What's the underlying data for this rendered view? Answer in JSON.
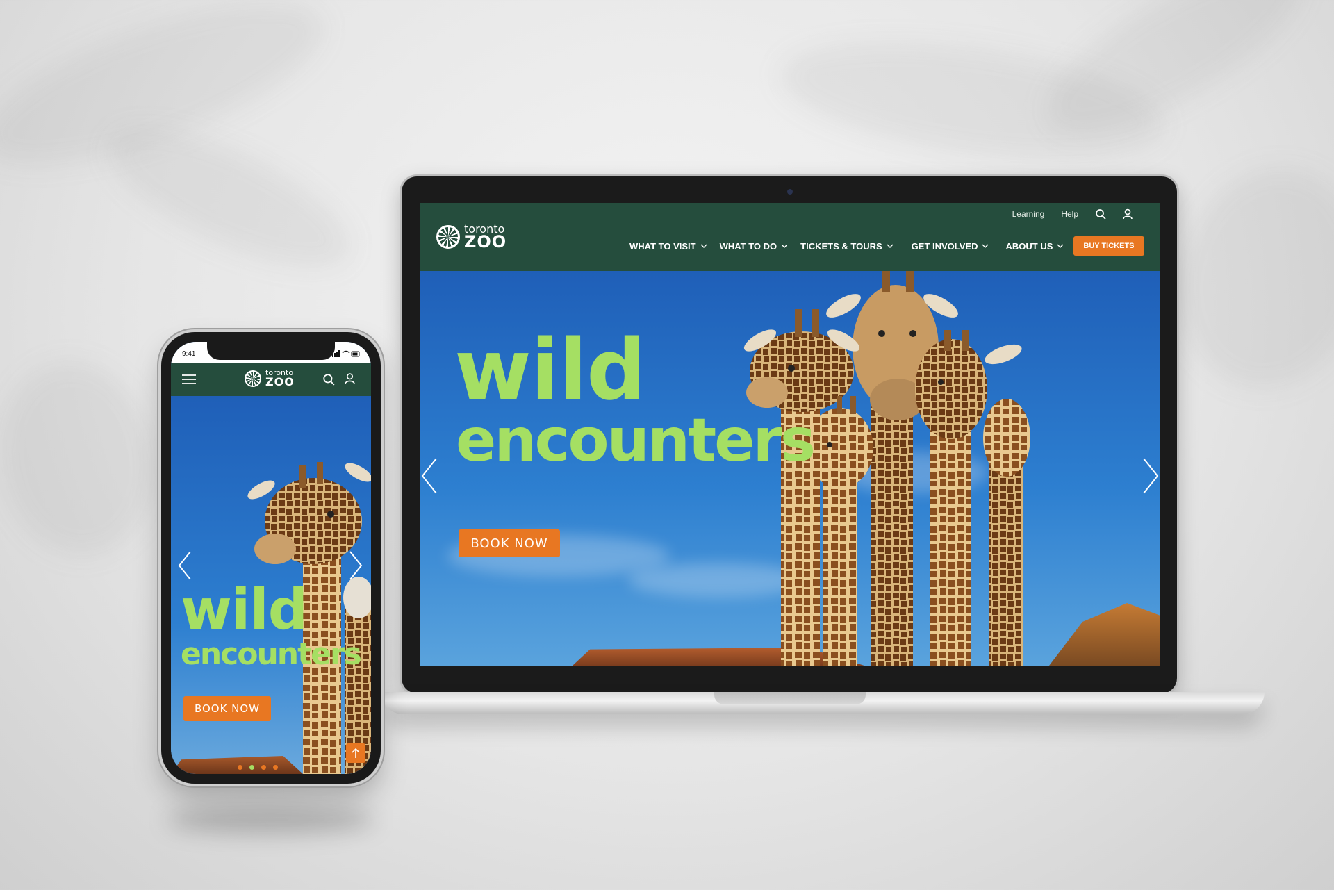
{
  "brand": {
    "small": "toronto",
    "big": "ZOO"
  },
  "desktop": {
    "utility": [
      "Learning",
      "Help"
    ],
    "nav": [
      {
        "label": "WHAT TO VISIT"
      },
      {
        "label": "WHAT TO DO"
      },
      {
        "label": "TICKETS & TOURS"
      },
      {
        "label": "GET INVOLVED"
      },
      {
        "label": "ABOUT US"
      }
    ],
    "buy_label": "BUY TICKETS",
    "hero": {
      "line1": "wild",
      "line2": "encounters",
      "cta": "BOOK NOW"
    }
  },
  "mobile": {
    "time": "9:41",
    "hero": {
      "line1": "wild",
      "line2": "encounters",
      "cta": "BOOK NOW"
    },
    "slides": 4,
    "active_slide": 2
  },
  "colors": {
    "header": "#254d3d",
    "accent": "#e87722",
    "headline": "#a5df63"
  },
  "icons": [
    "search-icon",
    "user-icon",
    "menu-icon",
    "chevron-left-icon",
    "chevron-right-icon",
    "arrow-up-icon",
    "chevron-down-icon"
  ]
}
